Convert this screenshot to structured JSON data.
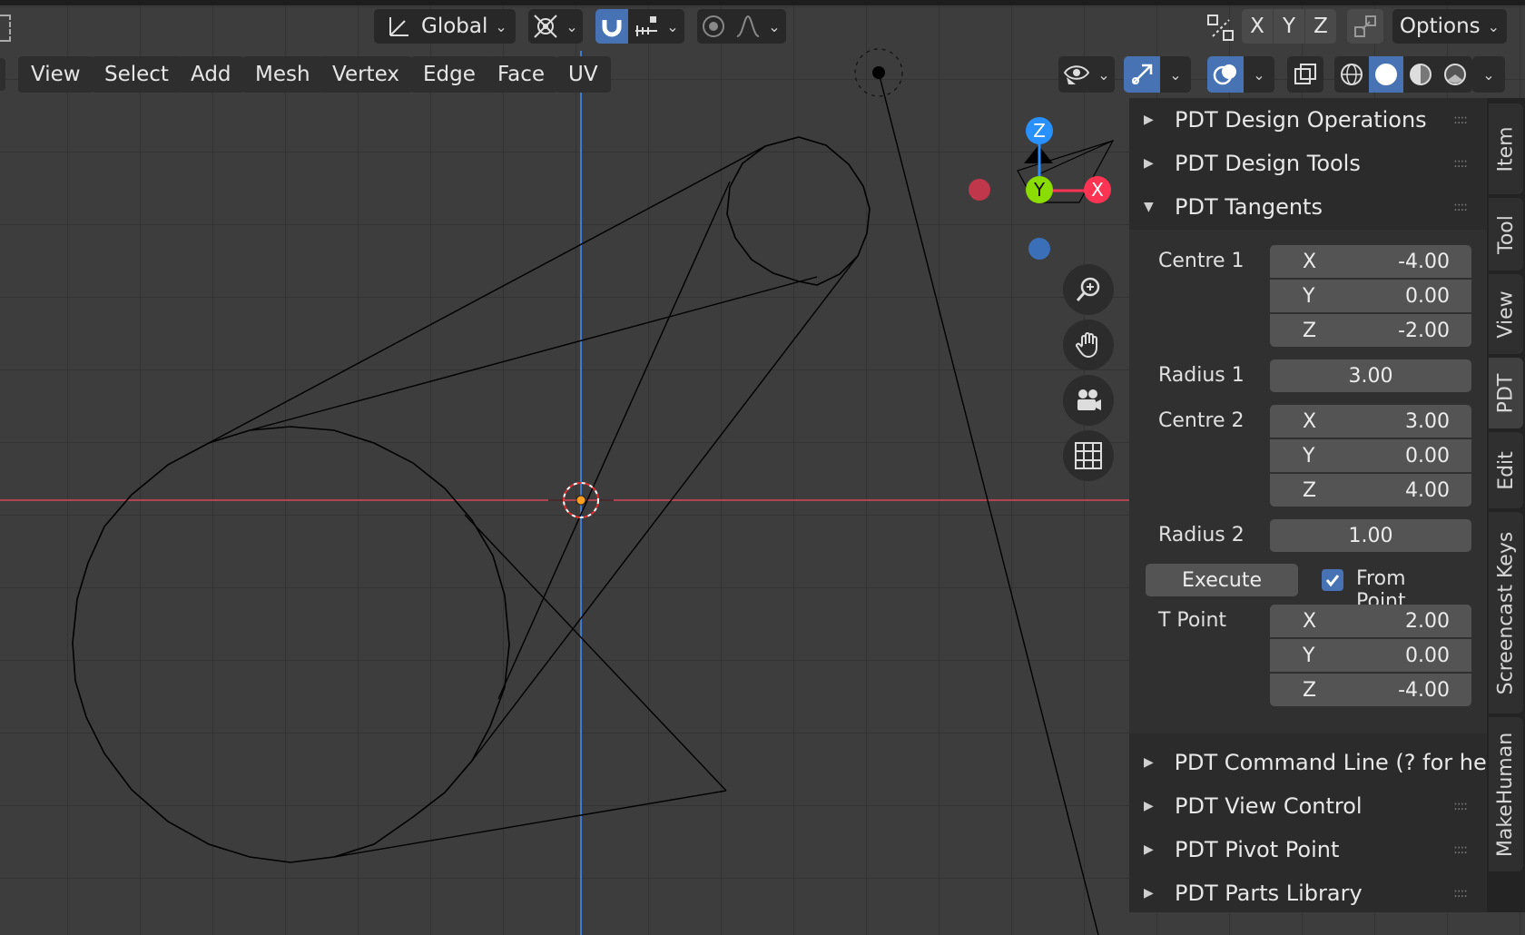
{
  "header": {
    "transform_orientation": "Global",
    "axes": [
      "X",
      "Y",
      "Z"
    ],
    "options_label": "Options",
    "icons": [
      "transform-orientation-icon",
      "pivot-point-icon",
      "snap-magnet-icon",
      "snap-increment-icon",
      "proportional-editing-icon",
      "falloff-curve-icon",
      "mirror-icon",
      "auto-merge-icon"
    ]
  },
  "menu": [
    "View",
    "Select",
    "Add",
    "Mesh",
    "Vertex",
    "Edge",
    "Face",
    "UV"
  ],
  "viewport_header_icons": [
    "visibility-eye-icon",
    "gizmo-icon",
    "overlays-icon",
    "xray-icon",
    "wireframe-shading-icon",
    "solid-shading-icon",
    "material-shading-icon",
    "rendered-shading-icon"
  ],
  "gizmo": {
    "z": "Z",
    "y": "Y",
    "x": "X"
  },
  "nav_tools": [
    "zoom-icon",
    "pan-hand-icon",
    "camera-icon",
    "ortho-grid-icon"
  ],
  "panels_top": [
    {
      "label": "PDT Design Operations",
      "expanded": false
    },
    {
      "label": "PDT Design Tools",
      "expanded": false
    },
    {
      "label": "PDT Tangents",
      "expanded": true
    }
  ],
  "tangents": {
    "centre1_label": "Centre 1",
    "centre1": {
      "x": "-4.00",
      "y": "0.00",
      "z": "-2.00"
    },
    "radius1_label": "Radius 1",
    "radius1": "3.00",
    "centre2_label": "Centre 2",
    "centre2": {
      "x": "3.00",
      "y": "0.00",
      "z": "4.00"
    },
    "radius2_label": "Radius 2",
    "radius2": "1.00",
    "execute_label": "Execute",
    "from_point_label": "From Point",
    "from_point_checked": true,
    "tpoint_label": "T Point",
    "tpoint": {
      "x": "2.00",
      "y": "0.00",
      "z": "-4.00"
    },
    "axis_x": "X",
    "axis_y": "Y",
    "axis_z": "Z"
  },
  "panels_bottom": [
    {
      "label": "PDT Command Line (? for help"
    },
    {
      "label": "PDT View Control"
    },
    {
      "label": "PDT Pivot Point"
    },
    {
      "label": "PDT Parts Library"
    }
  ],
  "tabs": [
    "Item",
    "Tool",
    "View",
    "PDT",
    "Edit",
    "Screencast Keys",
    "MakeHuman"
  ],
  "active_tab": "PDT",
  "colors": {
    "accent_blue": "#4772b3",
    "x_axis_red": "#ff3352",
    "y_axis_green": "#8bdc00",
    "z_axis_blue": "#2890ff",
    "origin_orange": "#ffa020"
  }
}
